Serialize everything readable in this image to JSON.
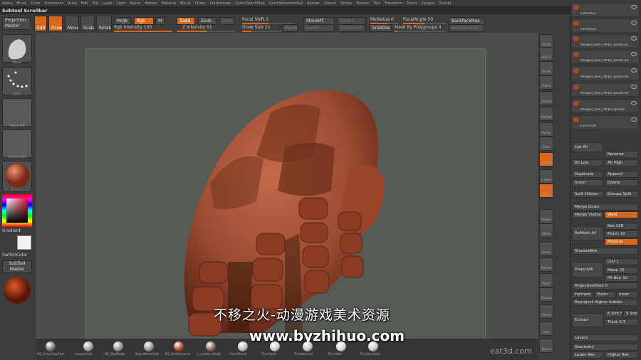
{
  "menu": [
    "Alpha",
    "Brush",
    "Color",
    "Document",
    "Draw",
    "Edit",
    "File",
    "Layer",
    "Light",
    "Macro",
    "Marker",
    "Material",
    "Movie",
    "Picker",
    "Preferences",
    "QuickSketchMod",
    "QuickSelectionMod",
    "Render",
    "Stencil",
    "Stroke",
    "Texture",
    "Tool",
    "Transform",
    "Zoom",
    "Zplugin",
    "Zscript"
  ],
  "subtool_scrollbar": "Subtool Scrollbar",
  "toolbar": {
    "projection_master": "Projection Master",
    "edit": "Edit",
    "draw": "Draw",
    "move": "Move",
    "scale": "Scale",
    "rotate": "Rotate",
    "mrgb": "Mrgb",
    "rgb": "Rgb",
    "m": "M",
    "rgb_intensity": "Rgb Intensity 100",
    "zadd": "Zadd",
    "zsub": "Zsub",
    "zcut": "Zcut",
    "z_intensity": "Z Intensity 51",
    "focal_shift": "Focal Shift 0",
    "draw_size": "Draw Size 22",
    "dynamic": "Dynamic",
    "storemt": "StoreMT",
    "delmt": "DelMT",
    "switch": "Switch",
    "transp": "TranspDiff",
    "midvalue": "MidValue 0",
    "grabdoc": "GrabDoc",
    "focalangle": "FocalAngle 50",
    "mask_polygroups": "Mask By Polygroups 0",
    "backfacemas": "BackfaceMas",
    "backmaskint": "BackMaskInt"
  },
  "left_shelf": {
    "move": "Move",
    "dots": "Dots",
    "alpha_off": "Alpha Off",
    "texture_off": "Texture Off",
    "material": "RS_RedChannel",
    "gradient": "Gradient",
    "switchcolor": "SwitchColor",
    "subtool_master": "SubTool Master"
  },
  "right_shelf": [
    "Scroll",
    "SPix 3",
    "Scroll",
    "Zoom",
    "Actual",
    "AAHalf",
    "Persp",
    "Floor",
    "Local",
    "L.Sym",
    "Xyz",
    "Frame",
    "Move",
    "Scale",
    "Rotate",
    "PolyF",
    "Transp",
    "Ghost",
    "Solo",
    "Xpose"
  ],
  "subtools": [
    "Extract22",
    "Extract23",
    "Merged_Skin_PM3D_Sando-01",
    "Merged_Skin_PM3D_Sando-00",
    "Merged_Skin_PM3D_Sando-00",
    "Merged_Skin_PM3D_Sando-00",
    "Merged_Skin_PM3D_Sphere",
    "Extract39"
  ],
  "panel": {
    "list_all": "List All",
    "rename": "Rename",
    "all_low": "All Low",
    "all_high": "All High",
    "duplicate": "Duplicate",
    "append": "Append",
    "insert": "Insert",
    "delete": "Delete",
    "split_hidden": "Split Hidden",
    "groups_split": "Groups Split",
    "merge_down": "Merge Down",
    "merge_visible": "Merge Visible",
    "weld": "Weld",
    "remesh_all": "ReMesh All",
    "res": "Res 128",
    "polish": "Polish 10",
    "polygrp": "PolyGrp",
    "shadowbox": "ShadowBox",
    "projectall": "ProjectAll",
    "dist": "Dist 1",
    "mean": "Mean 25",
    "pa_blur": "PA Blur 10",
    "projectionshell": "ProjectionShell 0",
    "farthest": "Farthest",
    "outer": "Outer",
    "inner": "Inner",
    "reproject": "Reproject Higher Subdiv",
    "extract": "Extract",
    "e_smt": "E Smt 5",
    "s_smt": "S Smt",
    "thick": "Thick 0.3",
    "layers": "Layers",
    "geometry": "Geometry",
    "lower_res": "Lower Res",
    "higher_res": "Higher Res"
  },
  "materials": [
    "RS_GreyClayExth",
    "maqueHe2",
    "RS_SkyMetal",
    "BasicMaterial2",
    "RS_RedChannel",
    "c_undoo_Mod2",
    "FormBrush",
    "TrimFront",
    "TrimNormal",
    "TrimHole",
    "TrimDynamic"
  ],
  "watermark_cn": "不移之火-动漫游戏美术资源",
  "watermark_url": "www.byzhihuo.com",
  "brand": "eat3d.com",
  "colors": {
    "accent": "#d9681f",
    "clay": "#a6462a"
  }
}
